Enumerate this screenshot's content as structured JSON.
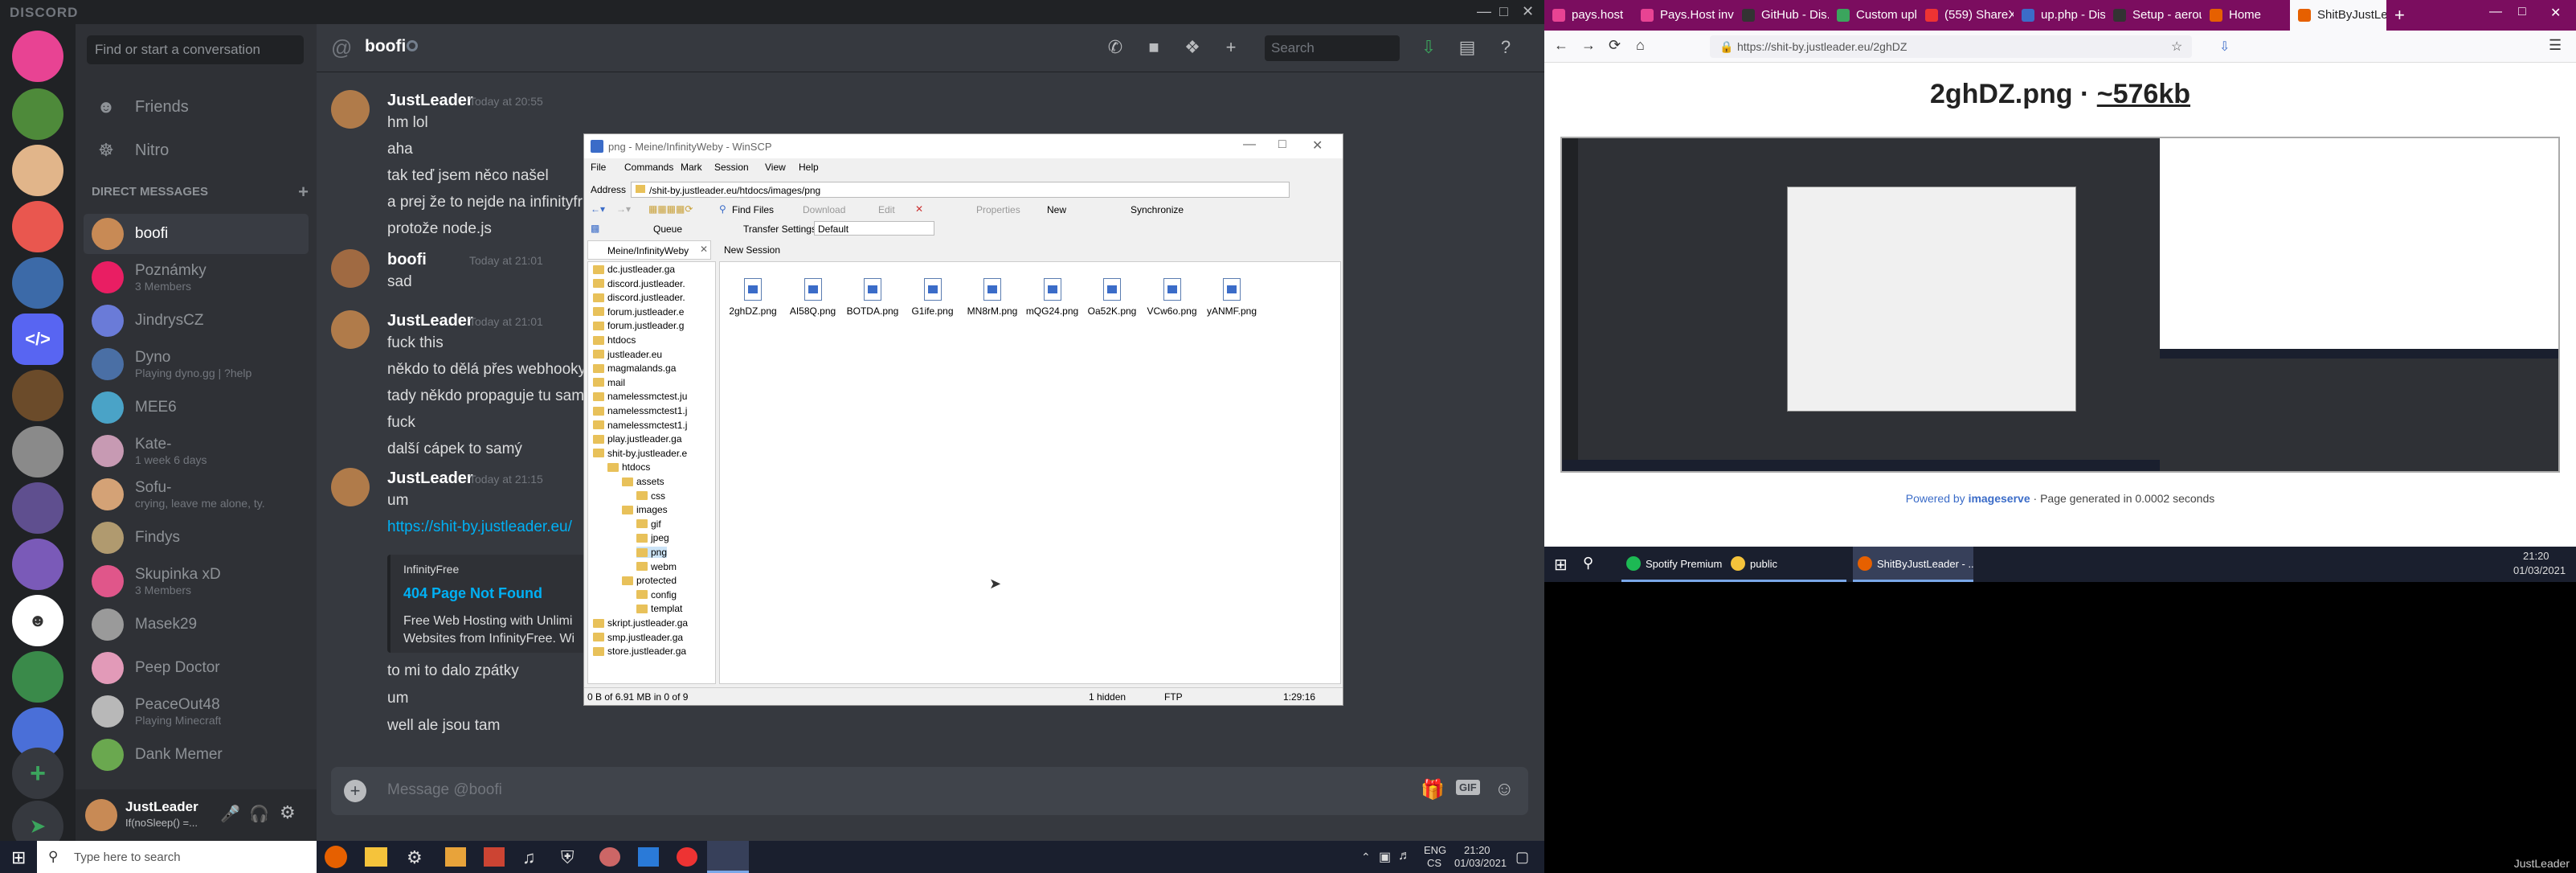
{
  "discord": {
    "app_title": "DISCORD",
    "search_placeholder": "Find or start a conversation",
    "nav": {
      "friends": "Friends",
      "nitro": "Nitro"
    },
    "dm_header": "DIRECT MESSAGES",
    "dms": [
      {
        "name": "boofi",
        "sub": "",
        "color": "#c88a55",
        "active": true
      },
      {
        "name": "Poznámky",
        "sub": "3 Members",
        "color": "#e91e63",
        "active": false
      },
      {
        "name": "JindrysCZ",
        "sub": "",
        "color": "#6a7bd8",
        "active": false
      },
      {
        "name": "Dyno",
        "sub": "Playing dyno.gg | ?help",
        "color": "#4a6fa5",
        "active": false
      },
      {
        "name": "MEE6",
        "sub": "",
        "color": "#4aa3c7",
        "active": false
      },
      {
        "name": "Kate-",
        "sub": "1 week 6 days",
        "color": "#c79ab3",
        "active": false
      },
      {
        "name": "Sofu-",
        "sub": "crying, leave me alone, ty.",
        "color": "#d4a276",
        "active": false
      },
      {
        "name": "Findys",
        "sub": "",
        "color": "#b09a6f",
        "active": false
      },
      {
        "name": "Skupinka xD",
        "sub": "3 Members",
        "color": "#e0568a",
        "active": false
      },
      {
        "name": "Masek29",
        "sub": "",
        "color": "#9a9a9a",
        "active": false
      },
      {
        "name": "Peep Doctor",
        "sub": "",
        "color": "#e29ab8",
        "active": false
      },
      {
        "name": "PeaceOut48",
        "sub": "Playing Minecraft",
        "color": "#b8b8b8",
        "active": false
      },
      {
        "name": "Dank Memer",
        "sub": "",
        "color": "#6aa84f",
        "active": false
      }
    ],
    "user": {
      "name": "JustLeader",
      "status": "If(noSleep() =..."
    },
    "channel": {
      "name": "boofi",
      "search": "Search"
    },
    "messages": [
      {
        "author": "JustLeader",
        "time": "Today at 20:55",
        "lines": [
          "hm lol",
          "aha",
          "tak teď jsem něco našel",
          "a prej že to nejde na infinityfr",
          "protože node.js"
        ]
      },
      {
        "author": "boofi",
        "time": "Today at 21:01",
        "lines": [
          "sad"
        ]
      },
      {
        "author": "JustLeader",
        "time": "Today at 21:01",
        "lines": [
          "fuck this",
          "někdo to dělá přes webhooky",
          "tady někdo propaguje tu samo",
          "fuck",
          "další cápek to samý"
        ]
      },
      {
        "author": "JustLeader",
        "time": "Today at 21:15",
        "lines": [
          "um",
          "https://shit-by.justleader.eu/"
        ]
      }
    ],
    "embed": {
      "provider": "InfinityFree",
      "title": "404 Page Not Found",
      "desc1": "Free Web Hosting with Unlimi",
      "desc2": "Websites from InfinityFree. Wi"
    },
    "after_lines": [
      "to mi to dalo zpátky",
      "um",
      "well ale jsou tam"
    ],
    "input_placeholder": "Message @boofi",
    "gif_label": "GIF"
  },
  "taskbar": {
    "search": "Type here to search",
    "lang1": "ENG",
    "lang2": "CS",
    "time": "21:20",
    "date": "01/03/2021"
  },
  "winscp": {
    "title": "png - Meine/InfinityWeby - WinSCP",
    "menu": [
      "File",
      "Commands",
      "Mark",
      "Session",
      "View",
      "Help"
    ],
    "address_label": "Address",
    "path": "/shit-by.justleader.eu/htdocs/images/png",
    "toolbar": {
      "find": "Find Files",
      "download": "Download",
      "edit": "Edit",
      "properties": "Properties",
      "new": "New",
      "sync": "Synchronize",
      "queue": "Queue",
      "transfer_label": "Transfer Settings",
      "transfer_value": "Default"
    },
    "tabs": [
      "Meine/InfinityWeby",
      "New Session"
    ],
    "tree": [
      "dc.justleader.ga",
      "discord.justleader.",
      "discord.justleader.",
      "forum.justleader.e",
      "forum.justleader.g",
      "htdocs",
      "justleader.eu",
      "magmalands.ga",
      "mail",
      "namelessmctest.ju",
      "namelessmctest1.j",
      "namelessmctest1.j",
      "play.justleader.ga",
      "shit-by.justleader.e",
      "htdocs",
      "assets",
      "css",
      "images",
      "gif",
      "jpeg",
      "png",
      "webm",
      "protected",
      "config",
      "templat",
      "skript.justleader.ga",
      "smp.justleader.ga",
      "store.justleader.ga"
    ],
    "files": [
      "2ghDZ.png",
      "AI58Q.png",
      "BOTDA.png",
      "G1ife.png",
      "MN8rM.png",
      "mQG24.png",
      "Oa52K.png",
      "VCw6o.png",
      "yANMF.png"
    ],
    "status": {
      "selection": "0 B of 6.91 MB in 0 of 9",
      "hidden": "1 hidden",
      "protocol": "FTP",
      "elapsed": "1:29:16"
    }
  },
  "browser": {
    "tabs": [
      "pays.host",
      "Pays.Host invite",
      "GitHub - Dis...",
      "Custom uplo...",
      "(559) ShareX",
      "up.php - Disk",
      "Setup - aerou...",
      "Home",
      "ShitByJustLea..."
    ],
    "url": "https://shit-by.justleader.eu/2ghDZ",
    "page_title": "2ghDZ.png · ~576kb",
    "powered_prefix": "Powered by ",
    "powered_link": "imageserve",
    "powered_suffix": " · Page generated in 0.0002 seconds",
    "taskbar_items": [
      "Spotify Premium",
      "public",
      "ShitByJustLeader - ..."
    ],
    "time": "21:20",
    "date": "01/03/2021",
    "footer_name": "JustLeader"
  }
}
